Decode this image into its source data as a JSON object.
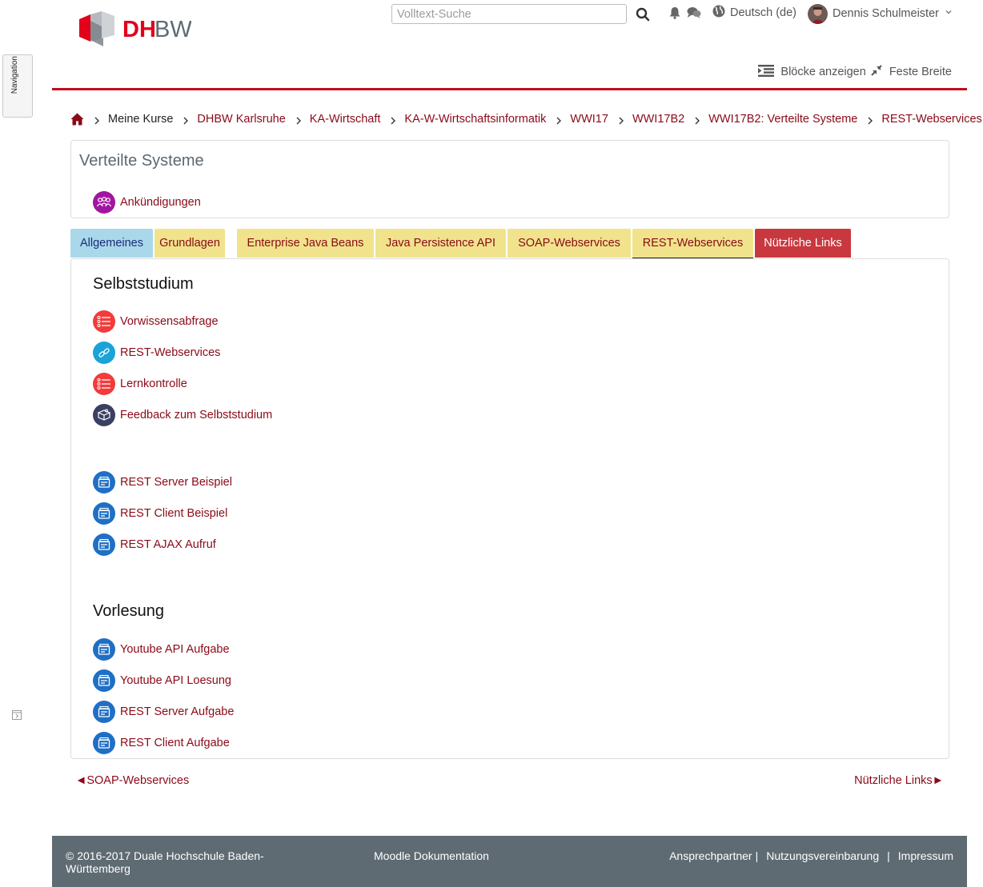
{
  "header": {
    "search_placeholder": "Volltext-Suche",
    "language": "Deutsch (de)",
    "user_name": "Dennis Schulmeister",
    "blocks_label": "Blöcke anzeigen",
    "width_label": "Feste Breite",
    "brand_color": "#c00d1e",
    "logo_text": "DHBW"
  },
  "nav_drawer": {
    "label": "Navigation"
  },
  "breadcrumb": {
    "items": [
      "Meine Kurse",
      "DHBW Karlsruhe",
      "KA-Wirtschaft",
      "KA-W-Wirtschaftsinformatik",
      "WWI17",
      "WWI17B2",
      "WWI17B2: Verteilte Systeme",
      "REST-Webservices"
    ]
  },
  "course": {
    "title": "Verteilte Systeme",
    "announcements": {
      "label": "Ankündigungen",
      "icon": "forum-icon",
      "color": "#a1169f"
    }
  },
  "tabs": [
    {
      "label": "Allgemeines",
      "color": "#a8d8ea",
      "state": "normal"
    },
    {
      "label": "Grundlagen",
      "color": "#f0e38c",
      "state": "normal"
    },
    {
      "label": "Enterprise Java Beans",
      "color": "#f0e38c",
      "state": "normal"
    },
    {
      "label": "Java Persistence API",
      "color": "#f0e38c",
      "state": "normal"
    },
    {
      "label": "SOAP-Webservices",
      "color": "#f0e38c",
      "state": "normal"
    },
    {
      "label": "REST-Webservices",
      "color": "#f0e38c",
      "state": "active"
    },
    {
      "label": "Nützliche Links",
      "color": "#c9383f",
      "state": "normal"
    }
  ],
  "sections": [
    {
      "title": "Selbststudium",
      "activities": [
        {
          "label": "Vorwissensabfrage",
          "icon": "quiz-icon",
          "color": "#f23b3b"
        },
        {
          "label": "REST-Webservices",
          "icon": "url-link-icon",
          "color": "#1aa3d6"
        },
        {
          "label": "Lernkontrolle",
          "icon": "quiz-icon",
          "color": "#f23b3b"
        },
        {
          "label": "Feedback zum Selbststudium",
          "icon": "feedback-icon",
          "color": "#3a3f63"
        }
      ]
    },
    {
      "title": "",
      "activities": [
        {
          "label": "REST Server Beispiel",
          "icon": "resource-icon",
          "color": "#1f6fc5"
        },
        {
          "label": "REST Client Beispiel",
          "icon": "resource-icon",
          "color": "#1f6fc5"
        },
        {
          "label": "REST AJAX Aufruf",
          "icon": "resource-icon",
          "color": "#1f6fc5"
        }
      ]
    },
    {
      "title": "Vorlesung",
      "activities": [
        {
          "label": "Youtube API Aufgabe",
          "icon": "resource-icon",
          "color": "#1f6fc5"
        },
        {
          "label": "Youtube API Loesung",
          "icon": "resource-icon",
          "color": "#1f6fc5"
        },
        {
          "label": "REST Server Aufgabe",
          "icon": "resource-icon",
          "color": "#1f6fc5"
        },
        {
          "label": "REST Client Aufgabe",
          "icon": "resource-icon",
          "color": "#1f6fc5"
        }
      ]
    }
  ],
  "pager": {
    "prev_arrow": "◄",
    "prev_label": "SOAP-Webservices",
    "next_label": "Nützliche Links",
    "next_arrow": "►"
  },
  "footer": {
    "copyright": "© 2016-2017 Duale Hochschule Baden-Württemberg",
    "docs_link": "Moodle Dokumentation",
    "links": [
      "Ansprechpartner",
      "Nutzungsvereinbarung",
      "Impressum"
    ],
    "separator": "|",
    "background": "#5f6b73"
  }
}
